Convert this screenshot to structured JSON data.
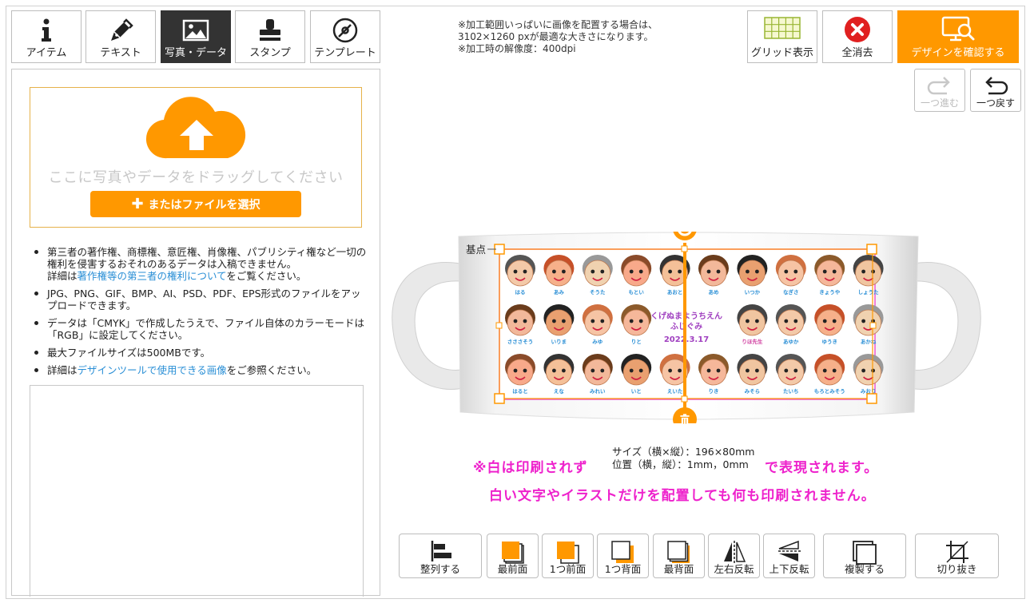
{
  "toolbar": {
    "tabs": [
      {
        "label": "アイテム",
        "icon": "info-icon"
      },
      {
        "label": "テキスト",
        "icon": "pen-icon"
      },
      {
        "label": "写真・データ",
        "icon": "image-icon",
        "active": true
      },
      {
        "label": "スタンプ",
        "icon": "stamp-icon"
      },
      {
        "label": "テンプレート",
        "icon": "template-icon"
      }
    ],
    "grid_label": "グリッド表示",
    "clear_label": "全消去",
    "confirm_label": "デザインを確認する",
    "redo_label": "一つ進む",
    "undo_label": "一つ戻す"
  },
  "info_note": {
    "line1": "※加工範囲いっぱいに画像を配置する場合は、",
    "line2": "3102×1260 pxが最適な大きさになります。",
    "line3": "※加工時の解像度：400dpi"
  },
  "upload": {
    "drop_text": "ここに写真やデータをドラッグしてください",
    "file_button": "またはファイルを選択",
    "file_button_icon": "plus-icon"
  },
  "notes": {
    "item1_a": "第三者の著作権、商標権、意匠権、肖像権、パブリシティ権など一切の権利を侵害するおそれのあるデータは入稿できません。",
    "item1_b": "詳細は",
    "item1_link": "著作権等の第三者の権利について",
    "item1_c": "をご覧ください。",
    "item2": "JPG、PNG、GIF、BMP、AI、PSD、PDF、EPS形式のファイルをアップロードできます。",
    "item3": "データは「CMYK」で作成したうえで、ファイル自体のカラーモードは「RGB」に設定してください。",
    "item4": "最大ファイルサイズは500MBです。",
    "item5_a": "詳細は",
    "item5_link": "デザインツールで使用できる画像",
    "item5_b": "をご参照ください。"
  },
  "canvas": {
    "anchor_label": "基点",
    "artwork": {
      "center_line1": "くげぬまようちえん",
      "center_line2": "ふじぐみ",
      "center_line3": "2022.3.17",
      "row1": [
        "はる",
        "あみ",
        "そうた",
        "もとい",
        "あおと",
        "あめ",
        "いつか",
        "なぎさ",
        "きょうや",
        "しょうた"
      ],
      "row2": [
        "さささそう",
        "いりま",
        "みゆ",
        "りと",
        "りほ先生",
        "あゆか",
        "ゆうき",
        "あかね"
      ],
      "row3": [
        "はると",
        "えな",
        "みれい",
        "いと",
        "えいた",
        "りき",
        "みそら",
        "たいち",
        "もろとみそう",
        "みおり"
      ]
    },
    "size_line": "サイズ（横×縦）：196×80mm",
    "position_line": "位置（横，縦）：1mm，0mm",
    "warning_line1": "※白は印刷されず",
    "warning_line1_end": "で表現されます。",
    "warning_line2": "白い文字やイラストだけを配置しても何も印刷されません。"
  },
  "bottom_toolbar": {
    "align": "整列する",
    "front_most": "最前面",
    "forward": "1つ前面",
    "backward": "1つ背面",
    "back_most": "最背面",
    "flip_h": "左右反転",
    "flip_v": "上下反転",
    "duplicate": "複製する",
    "crop": "切り抜き"
  },
  "colors": {
    "accent": "#ff9800",
    "warning": "#ee22cc",
    "link": "#2a8fd6",
    "active_tab": "#333333"
  }
}
